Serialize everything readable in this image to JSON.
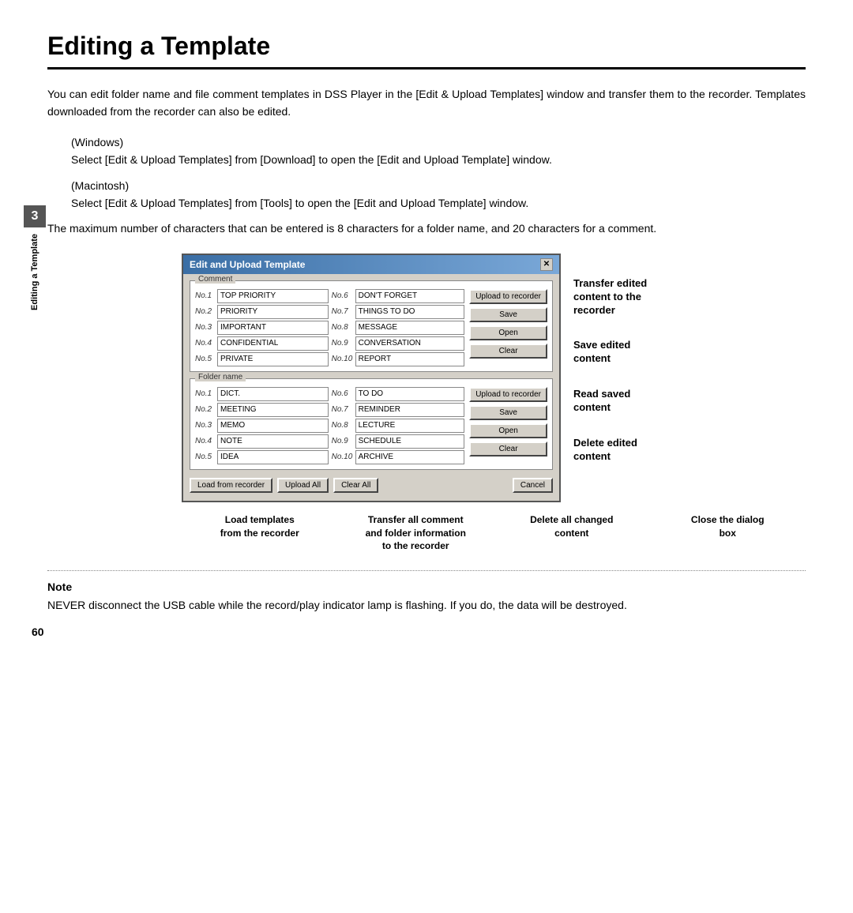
{
  "page": {
    "title": "Editing a Template",
    "chapter_number": "3",
    "side_label": "Editing a Template",
    "page_number": "60"
  },
  "intro": {
    "paragraph1": "You can edit folder name and file comment templates in DSS Player in the [Edit & Upload Templates] window and transfer them to the recorder. Templates downloaded from the recorder can also be edited.",
    "windows_label": "(Windows)",
    "windows_text": "Select [Edit & Upload Templates] from [Download] to open the [Edit and Upload Template] window.",
    "macintosh_label": "(Macintosh)",
    "macintosh_text": "Select [Edit & Upload Templates] from [Tools] to open the [Edit and Upload Template] window.",
    "max_chars": "The maximum number of characters that can be entered is 8 characters for a folder name, and 20 characters for a comment."
  },
  "dialog": {
    "title": "Edit and Upload Template",
    "comment_label": "Comment",
    "folder_label": "Folder name",
    "comment_rows": [
      {
        "num": "No.1",
        "left_value": "TOP PRIORITY",
        "right_num": "No.6",
        "right_value": "DON'T FORGET"
      },
      {
        "num": "No.2",
        "left_value": "PRIORITY",
        "right_num": "No.7",
        "right_value": "THINGS TO DO"
      },
      {
        "num": "No.3",
        "left_value": "IMPORTANT",
        "right_num": "No.8",
        "right_value": "MESSAGE"
      },
      {
        "num": "No.4",
        "left_value": "CONFIDENTIAL",
        "right_num": "No.9",
        "right_value": "CONVERSATION"
      },
      {
        "num": "No.5",
        "left_value": "PRIVATE",
        "right_num": "No.10",
        "right_value": "REPORT"
      }
    ],
    "folder_rows": [
      {
        "num": "No.1",
        "left_value": "DICT.",
        "right_num": "No.6",
        "right_value": "TO DO"
      },
      {
        "num": "No.2",
        "left_value": "MEETING",
        "right_num": "No.7",
        "right_value": "REMINDER"
      },
      {
        "num": "No.3",
        "left_value": "MEMO",
        "right_num": "No.8",
        "right_value": "LECTURE"
      },
      {
        "num": "No.4",
        "left_value": "NOTE",
        "right_num": "No.9",
        "right_value": "SCHEDULE"
      },
      {
        "num": "No.5",
        "left_value": "IDEA",
        "right_num": "No.10",
        "right_value": "ARCHIVE"
      }
    ],
    "comment_buttons": [
      "Upload to recorder",
      "Save",
      "Open",
      "Clear"
    ],
    "folder_buttons": [
      "Upload to recorder",
      "Save",
      "Open",
      "Clear"
    ],
    "bottom_buttons": [
      "Load from recorder",
      "Upload All",
      "Clear All",
      "Cancel"
    ]
  },
  "right_annotations": [
    "Transfer edited\ncontent to the\nrecorder",
    "Save edited\ncontent",
    "Read saved\ncontent",
    "Delete edited\ncontent"
  ],
  "bottom_annotations": [
    {
      "label": "Load templates\nfrom the recorder"
    },
    {
      "label": "Transfer all comment\nand folder information\nto the recorder"
    },
    {
      "label": "Delete all changed\ncontent"
    },
    {
      "label": "Close the dialog\nbox"
    }
  ],
  "note": {
    "title": "Note",
    "text": "NEVER disconnect the USB cable while the record/play indicator lamp is flashing. If you do, the data will be destroyed."
  }
}
